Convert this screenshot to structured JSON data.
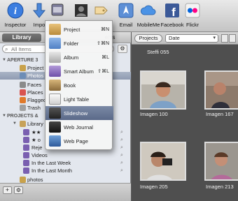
{
  "toolbar": {
    "inspector_label": "Inspector",
    "import_label": "Impo",
    "email_label": "Email",
    "mobileme_label": "MobileMe",
    "facebook_label": "Facebook",
    "flickr_label": "Flickr"
  },
  "sidebar": {
    "tab_library": "Library",
    "tab_events": "ents",
    "search_placeholder": "All Items",
    "aperture_header": "APERTURE 3",
    "projects_item": "Project",
    "photos_item": "Photos",
    "faces_item": "Faces",
    "places_item": "Places",
    "flagged_item": "Flagged",
    "trash_item": "Trash",
    "projects_header": "PROJECTS &",
    "library_item": "Library",
    "stars2_item": "★★",
    "stars1_item": "★ o",
    "rejected_item": "Reje",
    "videos_item": "Videos",
    "lastweek_item": "In the Last Week",
    "lastmonth_item": "In the Last Month",
    "photos2_item": "photos"
  },
  "browser": {
    "projects_button": "Projects",
    "sort_select": "Date",
    "captions": [
      "Steffi 055",
      "Imagen 100",
      "Imagen 167",
      "Imagen 205",
      "Imagen 213"
    ]
  },
  "menu": {
    "items": [
      {
        "label": "Project",
        "shortcut": "⌘N"
      },
      {
        "label": "Folder",
        "shortcut": "⇧⌘N"
      },
      {
        "label": "Album",
        "shortcut": "⌘L"
      },
      {
        "label": "Smart Album",
        "shortcut": "⇧⌘L"
      },
      {
        "label": "Book",
        "shortcut": ""
      },
      {
        "label": "Light Table",
        "shortcut": ""
      },
      {
        "label": "Slideshow",
        "shortcut": ""
      },
      {
        "label": "Web Journal",
        "shortcut": ""
      },
      {
        "label": "Web Page",
        "shortcut": ""
      }
    ]
  },
  "colors": {
    "menu_highlight": "#5b6a89",
    "sidebar_selection": "#8f9bb1",
    "browser_bg": "#4f4f4f"
  }
}
